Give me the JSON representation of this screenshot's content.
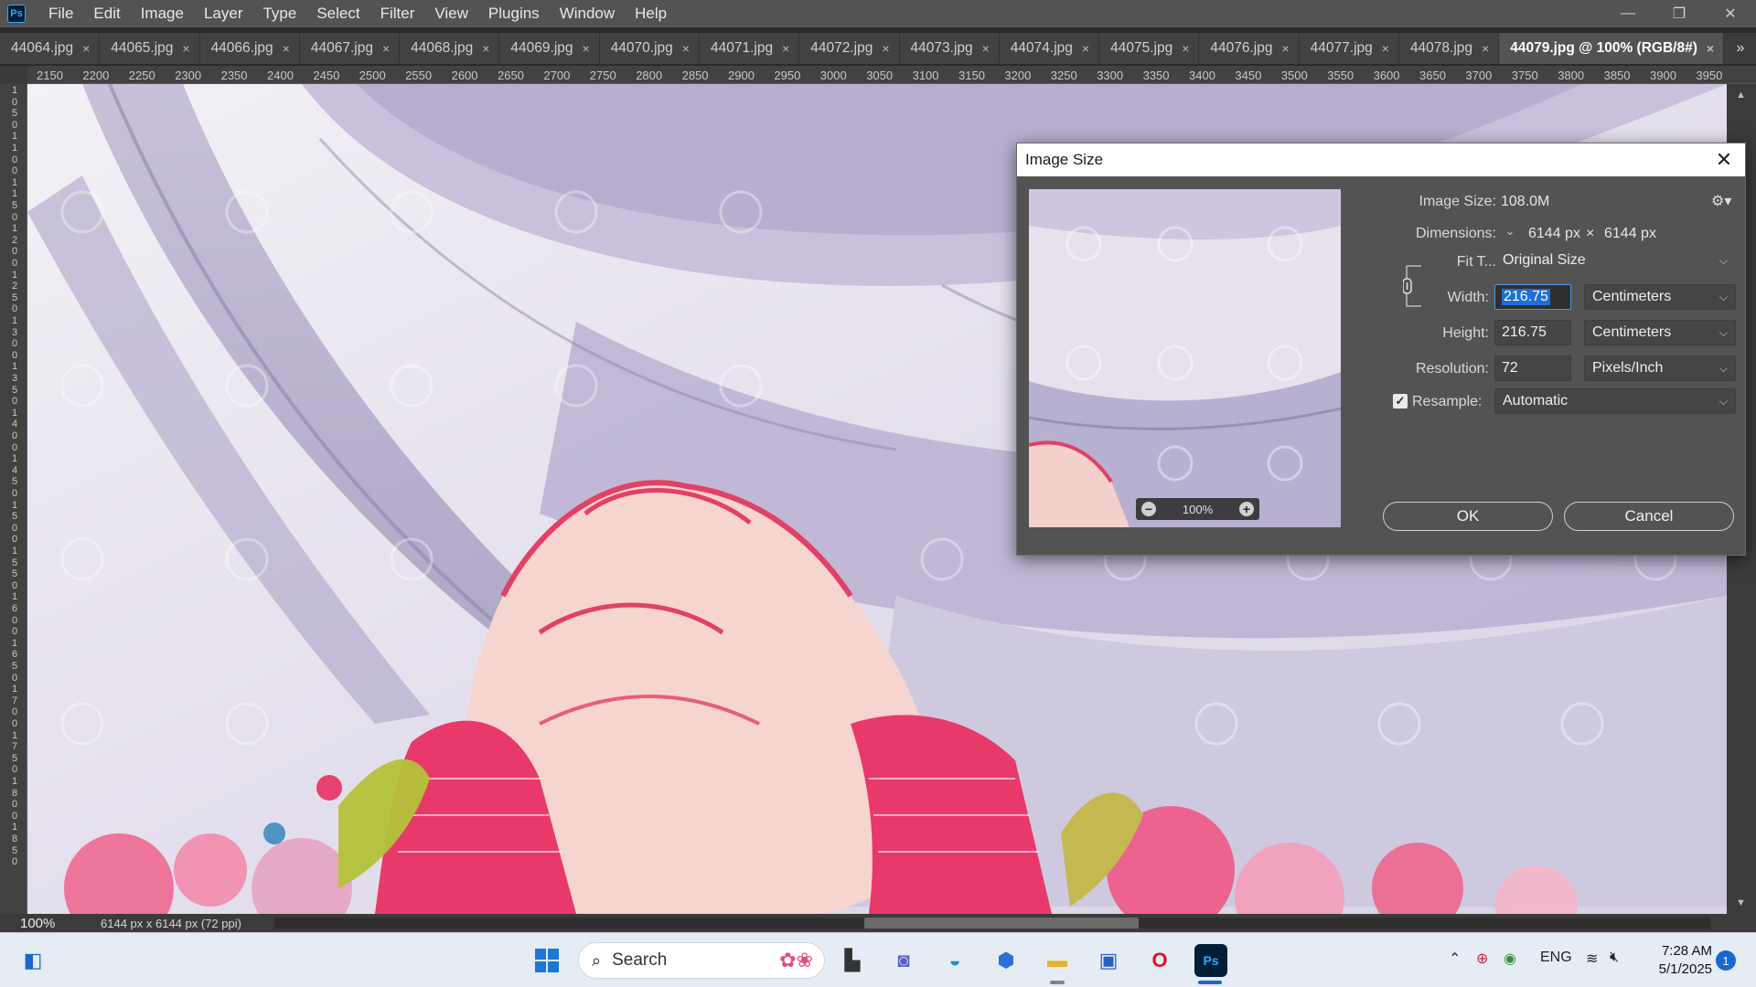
{
  "app": {
    "logo": "Ps"
  },
  "menu": [
    "File",
    "Edit",
    "Image",
    "Layer",
    "Type",
    "Select",
    "Filter",
    "View",
    "Plugins",
    "Window",
    "Help"
  ],
  "window_controls": {
    "minimize": "—",
    "restore": "❐",
    "close": "✕"
  },
  "tabs": [
    {
      "label": "44064.jpg"
    },
    {
      "label": "44065.jpg"
    },
    {
      "label": "44066.jpg"
    },
    {
      "label": "44067.jpg"
    },
    {
      "label": "44068.jpg"
    },
    {
      "label": "44069.jpg"
    },
    {
      "label": "44070.jpg"
    },
    {
      "label": "44071.jpg"
    },
    {
      "label": "44072.jpg"
    },
    {
      "label": "44073.jpg"
    },
    {
      "label": "44074.jpg"
    },
    {
      "label": "44075.jpg"
    },
    {
      "label": "44076.jpg"
    },
    {
      "label": "44077.jpg"
    },
    {
      "label": "44078.jpg"
    },
    {
      "label": "44079.jpg @ 100% (RGB/8#)",
      "active": true
    }
  ],
  "tab_overflow_icon": "double-chevron-right-icon",
  "ruler_top": [
    "2150",
    "2200",
    "2250",
    "2300",
    "2350",
    "2400",
    "2450",
    "2500",
    "2550",
    "2600",
    "2650",
    "2700",
    "2750",
    "2800",
    "2850",
    "2900",
    "2950",
    "3000",
    "3050",
    "3100",
    "3150",
    "3200",
    "3250",
    "3300",
    "3350",
    "3400",
    "3450",
    "3500",
    "3550",
    "3600",
    "3650",
    "3700",
    "3750",
    "3800",
    "3850",
    "3900",
    "3950"
  ],
  "ruler_left": [
    "1",
    "0",
    "5",
    "0",
    "1",
    "1",
    "0",
    "0",
    "1",
    "1",
    "5",
    "0",
    "1",
    "2",
    "0",
    "0",
    "1",
    "2",
    "5",
    "0",
    "1",
    "3",
    "0",
    "0",
    "1",
    "3",
    "5",
    "0",
    "1",
    "4",
    "0",
    "0",
    "1",
    "4",
    "5",
    "0",
    "1",
    "5",
    "0",
    "0",
    "1",
    "5",
    "5",
    "0",
    "1",
    "6",
    "0",
    "0",
    "1",
    "6",
    "5",
    "0",
    "1",
    "7",
    "0",
    "0",
    "1",
    "7",
    "5",
    "0",
    "1",
    "8",
    "0",
    "0",
    "1",
    "8",
    "5",
    "0"
  ],
  "status": {
    "zoom": "100%",
    "doc_info": "6144 px x 6144 px (72 ppi)",
    "arrow": "›",
    "scroll_left": "‹"
  },
  "dialog": {
    "title": "Image Size",
    "close": "✕",
    "image_size_label": "Image Size:",
    "image_size_value": "108.0M",
    "dimensions_label": "Dimensions:",
    "dimensions_width": "6144 px",
    "dimensions_sep": "×",
    "dimensions_height": "6144 px",
    "fit_to_label": "Fit T...",
    "fit_to_value": "Original Size",
    "width_label": "Width:",
    "width_value": "216.75",
    "width_unit": "Centimeters",
    "height_label": "Height:",
    "height_value": "216.75",
    "height_unit": "Centimeters",
    "resolution_label": "Resolution:",
    "resolution_value": "72",
    "resolution_unit": "Pixels/Inch",
    "resample_label": "Resample:",
    "resample_checked": true,
    "resample_value": "Automatic",
    "preview_zoom": "100%",
    "ok_label": "OK",
    "cancel_label": "Cancel"
  },
  "taskbar": {
    "search_label": "Search",
    "language": "ENG",
    "time": "7:28 AM",
    "date": "5/1/2025",
    "notification_count": "1"
  },
  "colors": {
    "accent": "#1e6fd6",
    "ps_blue": "#31a8ff",
    "dialog_bg": "#535353",
    "taskbar_bg": "#e6ecf4"
  }
}
